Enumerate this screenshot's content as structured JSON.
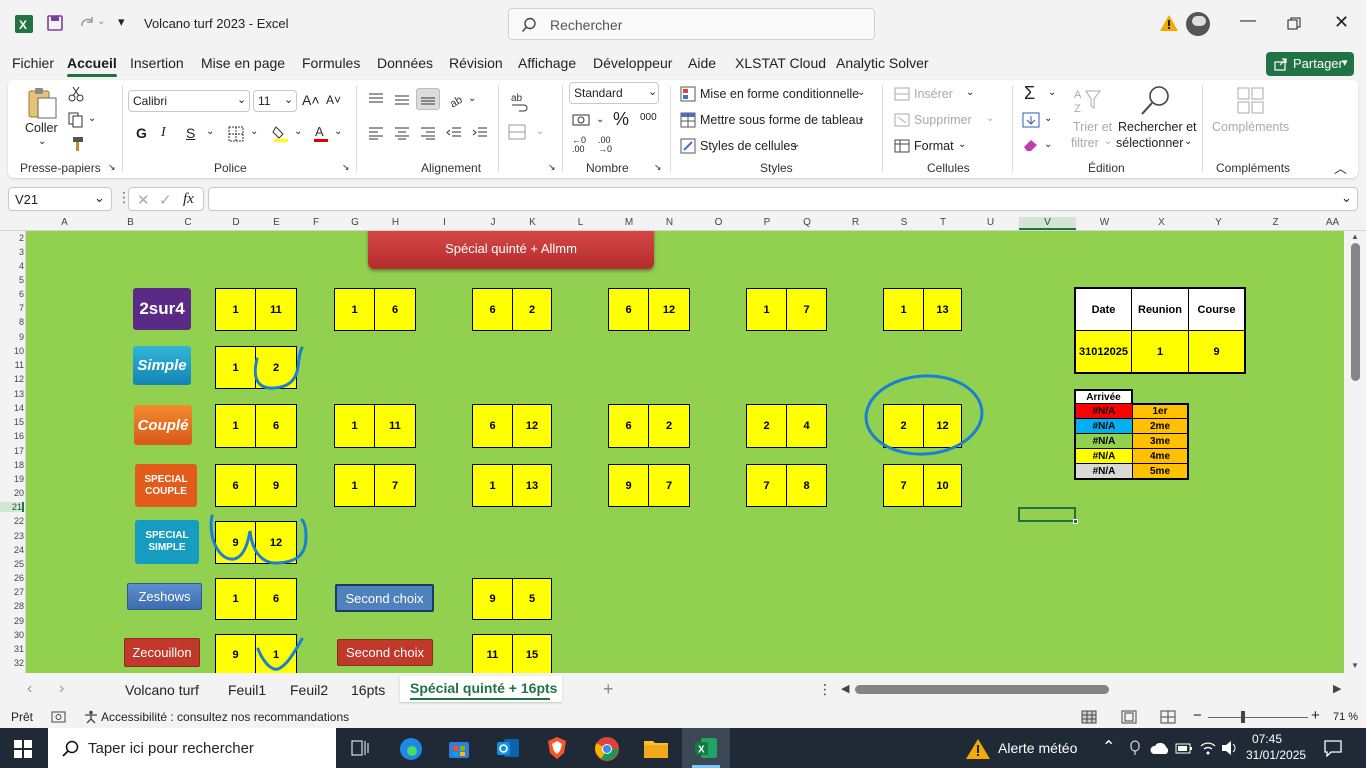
{
  "title": "Volcano turf 2023  -  Excel",
  "search": {
    "placeholder": "Rechercher"
  },
  "share_label": "Partager",
  "tabs": [
    "Fichier",
    "Accueil",
    "Insertion",
    "Mise en page",
    "Formules",
    "Données",
    "Révision",
    "Affichage",
    "Développeur",
    "Aide",
    "XLSTAT Cloud",
    "Analytic Solver"
  ],
  "ribbon": {
    "paste_label": "Coller",
    "font_name": "Calibri",
    "font_size": "11",
    "bold": "G",
    "italic": "I",
    "underline": "S",
    "number_format": "Standard",
    "cond_format": "Mise en forme conditionnelle",
    "table_format": "Mettre sous forme de tableau",
    "cell_styles": "Styles de cellules",
    "insert": "Insérer",
    "delete": "Supprimer",
    "format": "Format",
    "sort_filter_1": "Trier et",
    "sort_filter_2": "filtrer",
    "find_select_1": "Rechercher et",
    "find_select_2": "sélectionner",
    "addins": "Compléments",
    "groups": [
      "Presse-papiers",
      "Police",
      "Alignement",
      "Nombre",
      "Styles",
      "Cellules",
      "Édition",
      "Compléments"
    ]
  },
  "formula_bar": {
    "name_box": "V21",
    "fx": "fx",
    "value": ""
  },
  "columns": [
    "A",
    "B",
    "C",
    "D",
    "E",
    "F",
    "G",
    "H",
    "I",
    "J",
    "K",
    "L",
    "M",
    "N",
    "O",
    "P",
    "Q",
    "R",
    "S",
    "T",
    "U",
    "V",
    "W",
    "X",
    "Y",
    "Z",
    "AA"
  ],
  "rows": [
    "2",
    "3",
    "4",
    "5",
    "6",
    "7",
    "8",
    "9",
    "10",
    "11",
    "12",
    "13",
    "14",
    "15",
    "16",
    "17",
    "18",
    "19",
    "20",
    "21",
    "22",
    "23",
    "24",
    "25",
    "26",
    "27",
    "28",
    "29",
    "30",
    "31",
    "32"
  ],
  "sheet": {
    "banner": "Spécial quinté + Allmm",
    "logos": {
      "l2sur4": "2sur4",
      "simple": "Simple",
      "couple": "Couplé",
      "spcouple_1": "SPECIAL",
      "spcouple_2": "COUPLE",
      "spsimple_1": "SPECIAL",
      "spsimple_2": "SIMPLE"
    },
    "buttons": {
      "zeshows": "Zeshows",
      "second1": "Second choix",
      "zecouillon": "Zecouillon",
      "second2": "Second choix"
    },
    "cells": {
      "r1": [
        "1",
        "11",
        "1",
        "6",
        "6",
        "2",
        "6",
        "12",
        "1",
        "7",
        "1",
        "13"
      ],
      "r2": [
        "1",
        "2"
      ],
      "r3": [
        "1",
        "6",
        "1",
        "11",
        "6",
        "12",
        "6",
        "2",
        "2",
        "4",
        "2",
        "12"
      ],
      "r4": [
        "6",
        "9",
        "1",
        "7",
        "1",
        "13",
        "9",
        "7",
        "7",
        "8",
        "7",
        "10"
      ],
      "r5": [
        "9",
        "12"
      ],
      "r6": [
        "1",
        "6",
        "9",
        "5"
      ],
      "r7": [
        "9",
        "1",
        "11",
        "15"
      ]
    },
    "info_table": {
      "headers": [
        "Date",
        "Reunion",
        "Course"
      ],
      "values": [
        "31012025",
        "1",
        "9"
      ]
    },
    "arrivee": {
      "title": "Arrivée",
      "rows": [
        {
          "v": "#N/A",
          "rank": "1er",
          "color": "#ff0000"
        },
        {
          "v": "#N/A",
          "rank": "2me",
          "color": "#00b0f0"
        },
        {
          "v": "#N/A",
          "rank": "3me",
          "color": "#92d050"
        },
        {
          "v": "#N/A",
          "rank": "4me",
          "color": "#ffff00"
        },
        {
          "v": "#N/A",
          "rank": "5me",
          "color": "#d9d9d9"
        }
      ]
    }
  },
  "sheet_tabs": [
    "Volcano turf",
    "Feuil1",
    "Feuil2",
    "16pts",
    "Spécial quinté + 16pts"
  ],
  "status": {
    "ready": "Prêt",
    "accessibility": "Accessibilité : consultez nos recommandations",
    "zoom": "71 %"
  },
  "taskbar": {
    "search": "Taper ici pour rechercher",
    "weather": "Alerte météo",
    "time": "07:45",
    "date": "31/01/2025"
  },
  "colors": {
    "sheet_bg": "#92d050",
    "cell_yellow": "#ffff00",
    "excel_green": "#217346",
    "ink_blue": "#1a7fd6"
  }
}
